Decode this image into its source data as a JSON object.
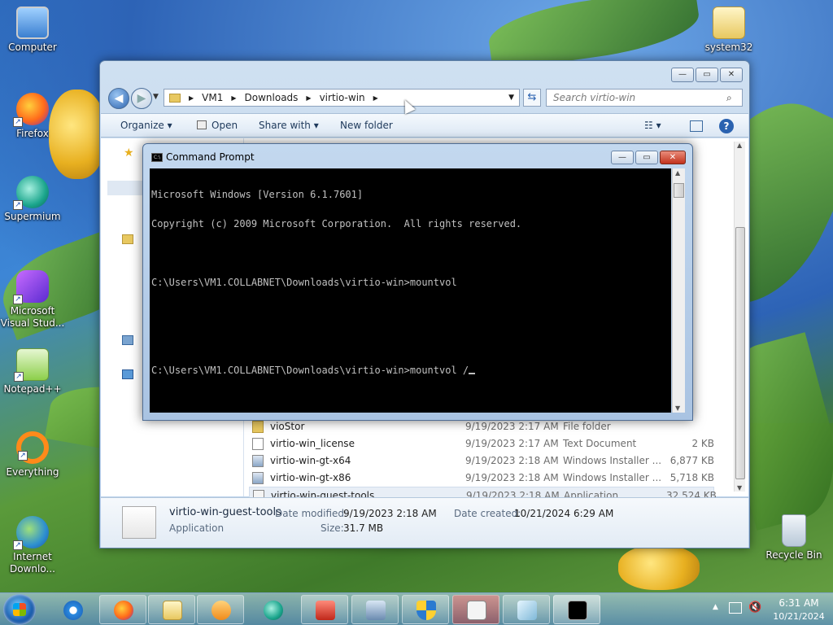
{
  "desktop": {
    "icons": [
      {
        "label": "Computer"
      },
      {
        "label": "Firefox"
      },
      {
        "label": "Supermium"
      },
      {
        "label": "Microsoft Visual Stud..."
      },
      {
        "label": "Notepad++"
      },
      {
        "label": "Everything"
      },
      {
        "label": "Internet Downlo..."
      },
      {
        "label": "system32"
      },
      {
        "label": "Recycle Bin"
      }
    ]
  },
  "explorer": {
    "breadcrumb": [
      "VM1",
      "Downloads",
      "virtio-win"
    ],
    "search_placeholder": "Search virtio-win",
    "toolbar": {
      "organize": "Organize",
      "open": "Open",
      "share_with": "Share with",
      "new_folder": "New folder"
    },
    "files": [
      {
        "name": "vioStor",
        "date": "9/19/2023 2:17 AM",
        "type": "File folder",
        "size": ""
      },
      {
        "name": "virtio-win_license",
        "date": "9/19/2023 2:17 AM",
        "type": "Text Document",
        "size": "2 KB"
      },
      {
        "name": "virtio-win-gt-x64",
        "date": "9/19/2023 2:18 AM",
        "type": "Windows Installer ...",
        "size": "6,877 KB"
      },
      {
        "name": "virtio-win-gt-x86",
        "date": "9/19/2023 2:18 AM",
        "type": "Windows Installer ...",
        "size": "5,718 KB"
      },
      {
        "name": "virtio-win-guest-tools",
        "date": "9/19/2023 2:18 AM",
        "type": "Application",
        "size": "32,524 KB"
      }
    ],
    "details": {
      "name": "virtio-win-guest-tools",
      "type": "Application",
      "date_modified_label": "Date modified:",
      "date_modified": "9/19/2023 2:18 AM",
      "size_label": "Size:",
      "size": "31.7 MB",
      "date_created_label": "Date created:",
      "date_created": "10/21/2024 6:29 AM"
    }
  },
  "cmd": {
    "title": "Command Prompt",
    "lines": [
      "Microsoft Windows [Version 6.1.7601]",
      "Copyright (c) 2009 Microsoft Corporation.  All rights reserved.",
      "",
      "C:\\Users\\VM1.COLLABNET\\Downloads\\virtio-win>mountvol",
      "",
      "",
      "C:\\Users\\VM1.COLLABNET\\Downloads\\virtio-win>mountvol /"
    ]
  },
  "taskbar": {
    "clock_time": "6:31 AM",
    "clock_date": "10/21/2024"
  }
}
